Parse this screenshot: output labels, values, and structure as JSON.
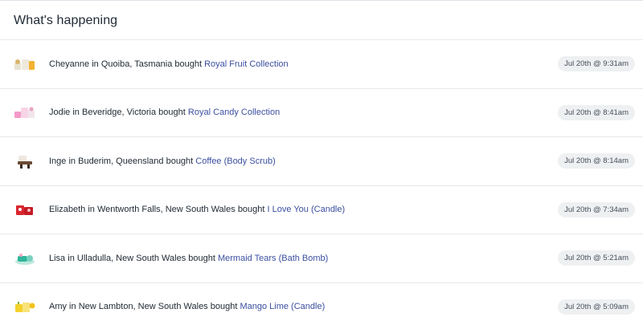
{
  "header": {
    "title": "What's happening"
  },
  "feed": [
    {
      "name": "Cheyanne",
      "location": "Quoiba, Tasmania",
      "verb": "bought",
      "product": "Royal Fruit Collection",
      "time": "Jul 20th @ 9:31am",
      "thumb_icon": "fruit-collection-thumbnail",
      "thumb_color": "#f2b233"
    },
    {
      "name": "Jodie",
      "location": "Beveridge, Victoria",
      "verb": "bought",
      "product": "Royal Candy Collection",
      "time": "Jul 20th @ 8:41am",
      "thumb_icon": "candy-collection-thumbnail",
      "thumb_color": "#f39ac8"
    },
    {
      "name": "Inge",
      "location": "Buderim, Queensland",
      "verb": "bought",
      "product": "Coffee (Body Scrub)",
      "time": "Jul 20th @ 8:14am",
      "thumb_icon": "coffee-scrub-thumbnail",
      "thumb_color": "#6b4a34"
    },
    {
      "name": "Elizabeth",
      "location": "Wentworth Falls, New South Wales",
      "verb": "bought",
      "product": "I Love You (Candle)",
      "time": "Jul 20th @ 7:34am",
      "thumb_icon": "love-candle-thumbnail",
      "thumb_color": "#d9262f"
    },
    {
      "name": "Lisa",
      "location": "Ulladulla, New South Wales",
      "verb": "bought",
      "product": "Mermaid Tears (Bath Bomb)",
      "time": "Jul 20th @ 5:21am",
      "thumb_icon": "mermaid-bath-bomb-thumbnail",
      "thumb_color": "#2fb59a"
    },
    {
      "name": "Amy",
      "location": "New Lambton, New South Wales",
      "verb": "bought",
      "product": "Mango Lime (Candle)",
      "time": "Jul 20th @ 5:09am",
      "thumb_icon": "mango-candle-thumbnail",
      "thumb_color": "#f3d22b"
    }
  ],
  "colors": {
    "link": "#3b4fa0",
    "badge_bg": "#eef0f2",
    "divider": "#e6e9ec",
    "text": "#212b36"
  }
}
